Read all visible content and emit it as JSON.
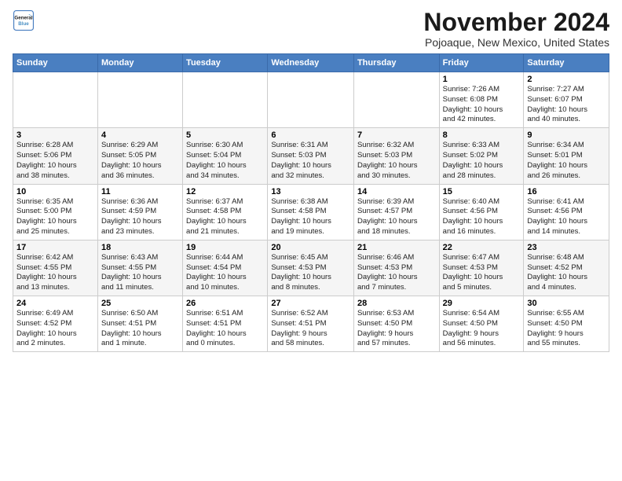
{
  "header": {
    "logo_line1": "General",
    "logo_line2": "Blue",
    "title": "November 2024",
    "location": "Pojoaque, New Mexico, United States"
  },
  "weekdays": [
    "Sunday",
    "Monday",
    "Tuesday",
    "Wednesday",
    "Thursday",
    "Friday",
    "Saturday"
  ],
  "weeks": [
    [
      {
        "day": "",
        "info": ""
      },
      {
        "day": "",
        "info": ""
      },
      {
        "day": "",
        "info": ""
      },
      {
        "day": "",
        "info": ""
      },
      {
        "day": "",
        "info": ""
      },
      {
        "day": "1",
        "info": "Sunrise: 7:26 AM\nSunset: 6:08 PM\nDaylight: 10 hours\nand 42 minutes."
      },
      {
        "day": "2",
        "info": "Sunrise: 7:27 AM\nSunset: 6:07 PM\nDaylight: 10 hours\nand 40 minutes."
      }
    ],
    [
      {
        "day": "3",
        "info": "Sunrise: 6:28 AM\nSunset: 5:06 PM\nDaylight: 10 hours\nand 38 minutes."
      },
      {
        "day": "4",
        "info": "Sunrise: 6:29 AM\nSunset: 5:05 PM\nDaylight: 10 hours\nand 36 minutes."
      },
      {
        "day": "5",
        "info": "Sunrise: 6:30 AM\nSunset: 5:04 PM\nDaylight: 10 hours\nand 34 minutes."
      },
      {
        "day": "6",
        "info": "Sunrise: 6:31 AM\nSunset: 5:03 PM\nDaylight: 10 hours\nand 32 minutes."
      },
      {
        "day": "7",
        "info": "Sunrise: 6:32 AM\nSunset: 5:03 PM\nDaylight: 10 hours\nand 30 minutes."
      },
      {
        "day": "8",
        "info": "Sunrise: 6:33 AM\nSunset: 5:02 PM\nDaylight: 10 hours\nand 28 minutes."
      },
      {
        "day": "9",
        "info": "Sunrise: 6:34 AM\nSunset: 5:01 PM\nDaylight: 10 hours\nand 26 minutes."
      }
    ],
    [
      {
        "day": "10",
        "info": "Sunrise: 6:35 AM\nSunset: 5:00 PM\nDaylight: 10 hours\nand 25 minutes."
      },
      {
        "day": "11",
        "info": "Sunrise: 6:36 AM\nSunset: 4:59 PM\nDaylight: 10 hours\nand 23 minutes."
      },
      {
        "day": "12",
        "info": "Sunrise: 6:37 AM\nSunset: 4:58 PM\nDaylight: 10 hours\nand 21 minutes."
      },
      {
        "day": "13",
        "info": "Sunrise: 6:38 AM\nSunset: 4:58 PM\nDaylight: 10 hours\nand 19 minutes."
      },
      {
        "day": "14",
        "info": "Sunrise: 6:39 AM\nSunset: 4:57 PM\nDaylight: 10 hours\nand 18 minutes."
      },
      {
        "day": "15",
        "info": "Sunrise: 6:40 AM\nSunset: 4:56 PM\nDaylight: 10 hours\nand 16 minutes."
      },
      {
        "day": "16",
        "info": "Sunrise: 6:41 AM\nSunset: 4:56 PM\nDaylight: 10 hours\nand 14 minutes."
      }
    ],
    [
      {
        "day": "17",
        "info": "Sunrise: 6:42 AM\nSunset: 4:55 PM\nDaylight: 10 hours\nand 13 minutes."
      },
      {
        "day": "18",
        "info": "Sunrise: 6:43 AM\nSunset: 4:55 PM\nDaylight: 10 hours\nand 11 minutes."
      },
      {
        "day": "19",
        "info": "Sunrise: 6:44 AM\nSunset: 4:54 PM\nDaylight: 10 hours\nand 10 minutes."
      },
      {
        "day": "20",
        "info": "Sunrise: 6:45 AM\nSunset: 4:53 PM\nDaylight: 10 hours\nand 8 minutes."
      },
      {
        "day": "21",
        "info": "Sunrise: 6:46 AM\nSunset: 4:53 PM\nDaylight: 10 hours\nand 7 minutes."
      },
      {
        "day": "22",
        "info": "Sunrise: 6:47 AM\nSunset: 4:53 PM\nDaylight: 10 hours\nand 5 minutes."
      },
      {
        "day": "23",
        "info": "Sunrise: 6:48 AM\nSunset: 4:52 PM\nDaylight: 10 hours\nand 4 minutes."
      }
    ],
    [
      {
        "day": "24",
        "info": "Sunrise: 6:49 AM\nSunset: 4:52 PM\nDaylight: 10 hours\nand 2 minutes."
      },
      {
        "day": "25",
        "info": "Sunrise: 6:50 AM\nSunset: 4:51 PM\nDaylight: 10 hours\nand 1 minute."
      },
      {
        "day": "26",
        "info": "Sunrise: 6:51 AM\nSunset: 4:51 PM\nDaylight: 10 hours\nand 0 minutes."
      },
      {
        "day": "27",
        "info": "Sunrise: 6:52 AM\nSunset: 4:51 PM\nDaylight: 9 hours\nand 58 minutes."
      },
      {
        "day": "28",
        "info": "Sunrise: 6:53 AM\nSunset: 4:50 PM\nDaylight: 9 hours\nand 57 minutes."
      },
      {
        "day": "29",
        "info": "Sunrise: 6:54 AM\nSunset: 4:50 PM\nDaylight: 9 hours\nand 56 minutes."
      },
      {
        "day": "30",
        "info": "Sunrise: 6:55 AM\nSunset: 4:50 PM\nDaylight: 9 hours\nand 55 minutes."
      }
    ]
  ]
}
